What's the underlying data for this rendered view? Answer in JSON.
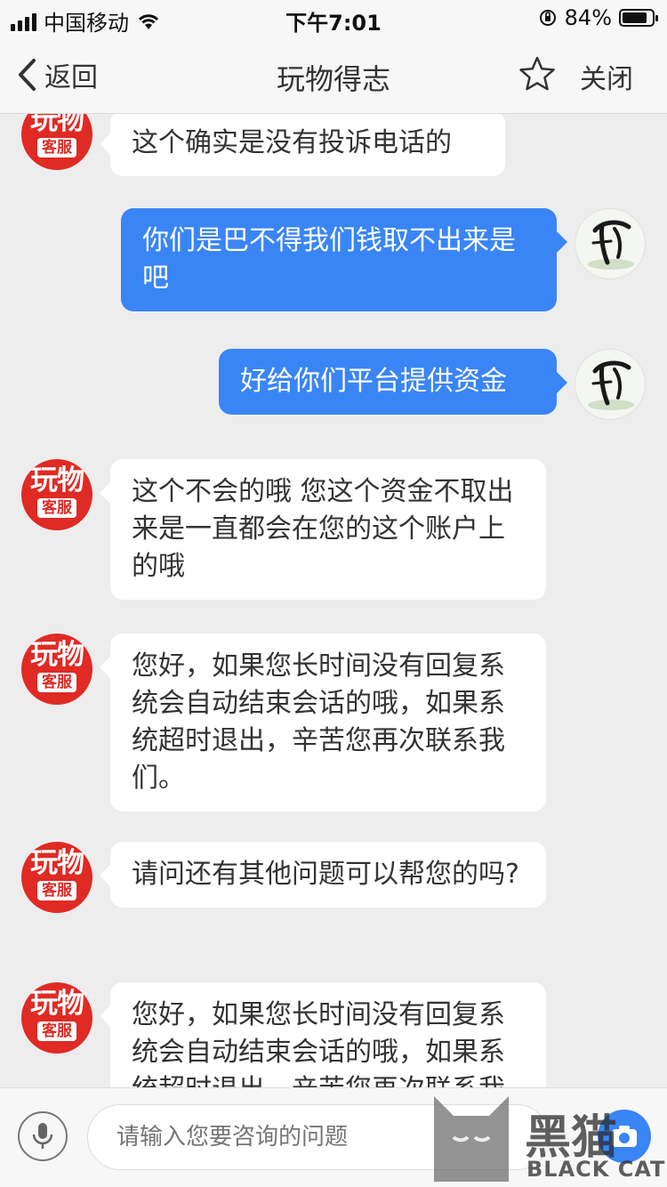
{
  "status_bar": {
    "carrier": "中国移动",
    "time": "下午7:01",
    "battery_percent": "84%",
    "battery_level": 0.84
  },
  "nav": {
    "back_label": "返回",
    "title": "玩物得志",
    "close_label": "关闭"
  },
  "avatars": {
    "service_line1": "玩物",
    "service_line2": "客服"
  },
  "messages": [
    {
      "side": "left",
      "text": "这个确实是没有投诉电话的"
    },
    {
      "side": "right",
      "text": "你们是巴不得我们钱取不出来是吧"
    },
    {
      "side": "right",
      "text": "好给你们平台提供资金"
    },
    {
      "side": "left",
      "text": "这个不会的哦 您这个资金不取出来是一直都会在您的这个账户上的哦"
    },
    {
      "side": "left",
      "text": "您好，如果您长时间没有回复系统会自动结束会话的哦，如果系统超时退出，辛苦您再次联系我们。"
    },
    {
      "side": "left",
      "text": "请问还有其他问题可以帮您的吗?"
    },
    {
      "side": "left",
      "text": "您好，如果您长时间没有回复系统会自动结束会话的哦，如果系统超时退出，辛苦您再次联系我们。"
    }
  ],
  "input": {
    "placeholder": "请输入您要咨询的问题"
  },
  "watermark": {
    "title": "黑猫",
    "subtitle": "BLACK CAT"
  },
  "colors": {
    "accent": "#3a85f5",
    "service_red": "#e02a24",
    "background": "#ededed"
  }
}
